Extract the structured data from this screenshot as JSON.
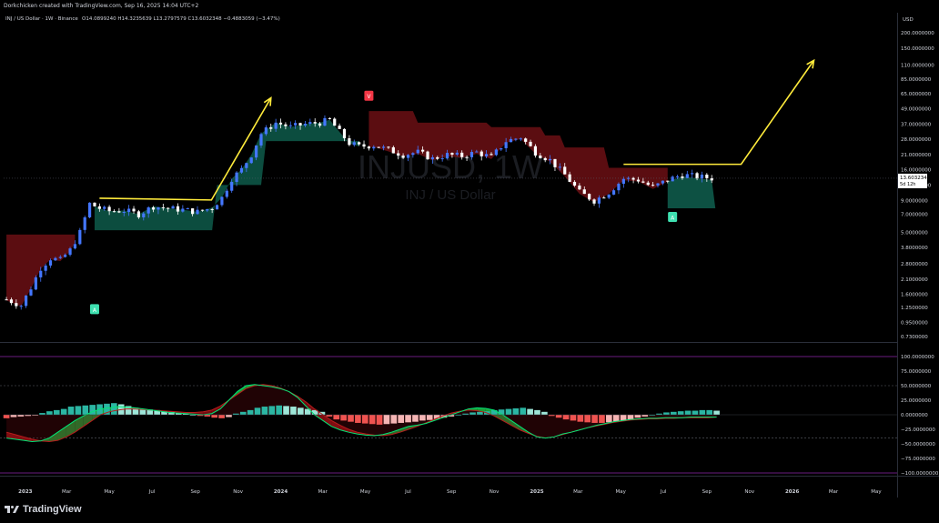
{
  "header": {
    "text": "Dorkchicken created with TradingView.com, Sep 16, 2025 14:04 UTC+2"
  },
  "footer": {
    "brand": "TradingView"
  },
  "chart_data": [
    {
      "type": "candlestick",
      "title": "INJ / US Dollar · 1W · Binance",
      "ohlc_text": "O14.0899240  H14.3235639  L13.2797579  C13.6032348  −0.4883059 (−3.47%)",
      "watermark": {
        "symbol": "INJUSD, 1W",
        "name": "INJ / US Dollar"
      },
      "currency": "USD",
      "scale": "log",
      "last_price": "13.6032348",
      "countdown": "5d 12h",
      "yticks": [
        "200.0000000",
        "150.0000000",
        "110.0000000",
        "85.0000000",
        "65.0000000",
        "49.0000000",
        "37.0000000",
        "28.0000000",
        "21.0000000",
        "16.0000000",
        "12.0000000",
        "9.0000000",
        "7.0000000",
        "5.0000000",
        "3.8000000",
        "2.8000000",
        "2.1000000",
        "1.6000000",
        "1.2500000",
        "0.9500000",
        "0.7300000"
      ],
      "xticks": [
        "2023",
        "Mar",
        "May",
        "Jul",
        "Sep",
        "Nov",
        "2024",
        "Mar",
        "May",
        "Jul",
        "Sep",
        "Nov",
        "2025",
        "Mar",
        "May",
        "Jul",
        "Sep",
        "Nov",
        "2026",
        "Mar",
        "May"
      ],
      "x_range": [
        "2022-12",
        "2026-05"
      ],
      "price_path": [
        [
          "2022-12-05",
          1.45
        ],
        [
          "2022-12-26",
          1.3
        ],
        [
          "2023-01-09",
          1.8
        ],
        [
          "2023-01-23",
          2.6
        ],
        [
          "2023-02-06",
          3.1
        ],
        [
          "2023-02-20",
          3.0
        ],
        [
          "2023-03-06",
          3.6
        ],
        [
          "2023-03-20",
          5.0
        ],
        [
          "2023-04-03",
          8.5
        ],
        [
          "2023-04-17",
          7.8
        ],
        [
          "2023-05-01",
          7.4
        ],
        [
          "2023-05-22",
          7.5
        ],
        [
          "2023-06-12",
          7.0
        ],
        [
          "2023-07-03",
          8.1
        ],
        [
          "2023-07-24",
          7.8
        ],
        [
          "2023-08-14",
          7.6
        ],
        [
          "2023-09-04",
          7.3
        ],
        [
          "2023-09-25",
          7.9
        ],
        [
          "2023-10-09",
          9.5
        ],
        [
          "2023-10-23",
          13.5
        ],
        [
          "2023-11-06",
          16.0
        ],
        [
          "2023-11-20",
          21.0
        ],
        [
          "2023-12-04",
          31.0
        ],
        [
          "2023-12-25",
          38.0
        ],
        [
          "2024-01-15",
          35.0
        ],
        [
          "2024-02-05",
          37.0
        ],
        [
          "2024-02-26",
          38.0
        ],
        [
          "2024-03-11",
          40.0
        ],
        [
          "2024-03-25",
          32.0
        ],
        [
          "2024-04-08",
          26.0
        ],
        [
          "2024-04-22",
          24.5
        ],
        [
          "2024-05-13",
          25.0
        ],
        [
          "2024-06-03",
          23.0
        ],
        [
          "2024-06-24",
          21.0
        ],
        [
          "2024-07-15",
          22.0
        ],
        [
          "2024-08-05",
          19.5
        ],
        [
          "2024-08-26",
          21.0
        ],
        [
          "2024-09-16",
          20.5
        ],
        [
          "2024-10-07",
          22.0
        ],
        [
          "2024-10-28",
          20.0
        ],
        [
          "2024-11-18",
          27.0
        ],
        [
          "2024-12-09",
          29.0
        ],
        [
          "2024-12-30",
          22.0
        ],
        [
          "2025-01-20",
          19.0
        ],
        [
          "2025-02-10",
          14.5
        ],
        [
          "2025-03-03",
          10.5
        ],
        [
          "2025-03-24",
          9.0
        ],
        [
          "2025-04-14",
          10.5
        ],
        [
          "2025-05-05",
          13.5
        ],
        [
          "2025-05-26",
          13.2
        ],
        [
          "2025-06-16",
          11.5
        ],
        [
          "2025-07-07",
          13.2
        ],
        [
          "2025-07-28",
          14.5
        ],
        [
          "2025-08-18",
          14.0
        ],
        [
          "2025-09-08",
          13.6
        ]
      ],
      "signals": [
        {
          "type": "buy",
          "label": "A",
          "date": "2023-04-10",
          "price": 1.2
        },
        {
          "type": "sell",
          "label": "V",
          "date": "2024-05-06",
          "price": 62
        },
        {
          "type": "buy",
          "label": "A",
          "date": "2025-07-14",
          "price": 6.6
        }
      ],
      "annotations": [
        {
          "type": "line",
          "color": "#ffeb3b",
          "points": [
            [
              "2023-04-17",
              9.4
            ],
            [
              "2023-09-24",
              9.1
            ],
            [
              "2023-12-18",
              60.0
            ]
          ],
          "arrow": true
        },
        {
          "type": "line",
          "color": "#ffeb3b",
          "points": [
            [
              "2025-05-05",
              17.6
            ],
            [
              "2025-10-20",
              17.6
            ],
            [
              "2026-02-01",
              120.0
            ]
          ],
          "arrow": true
        }
      ],
      "colors": {
        "bull": "#4477ff",
        "bear": "#ffffff",
        "band_bull": "#0e5a4a",
        "band_bear": "#6b0f14",
        "signal_buy": "#3ee0b0",
        "signal_sell": "#f23645",
        "arrow": "#ffeb3b"
      }
    },
    {
      "type": "oscillator",
      "yticks": [
        "100.0000000",
        "75.0000000",
        "50.0000000",
        "25.0000000",
        "0.0000000",
        "−25.0000000",
        "−50.0000000",
        "−75.0000000",
        "−100.0000000"
      ],
      "ylim": [
        -100,
        100
      ],
      "reference_lines": [
        100,
        50,
        -40,
        -100
      ],
      "histogram": [
        -6,
        -4,
        -3,
        -2,
        -1,
        3,
        6,
        8,
        10,
        14,
        15,
        16,
        17,
        18,
        19,
        20,
        18,
        15,
        12,
        10,
        9,
        8,
        6,
        5,
        3,
        2,
        0,
        -2,
        -3,
        -5,
        -6,
        -4,
        2,
        5,
        8,
        12,
        14,
        15,
        16,
        15,
        14,
        12,
        10,
        8,
        5,
        -3,
        -8,
        -10,
        -12,
        -14,
        -15,
        -16,
        -17,
        -16,
        -15,
        -14,
        -13,
        -12,
        -10,
        -9,
        -7,
        -5,
        -3,
        0,
        2,
        4,
        5,
        6,
        8,
        9,
        10,
        11,
        12,
        10,
        8,
        5,
        -2,
        -5,
        -8,
        -10,
        -12,
        -13,
        -14,
        -14,
        -13,
        -12,
        -10,
        -8,
        -5,
        -3,
        0,
        2,
        4,
        5,
        6,
        7,
        7,
        8,
        8,
        7
      ],
      "wave_fast": [
        -40,
        -42,
        -44,
        -46,
        -45,
        -40,
        -30,
        -20,
        -10,
        -2,
        5,
        10,
        12,
        14,
        13,
        12,
        10,
        8,
        6,
        4,
        3,
        2,
        1,
        0,
        2,
        10,
        25,
        40,
        50,
        52,
        50,
        48,
        45,
        40,
        30,
        15,
        0,
        -10,
        -20,
        -26,
        -30,
        -33,
        -35,
        -36,
        -34,
        -30,
        -25,
        -20,
        -18,
        -15,
        -10,
        -5,
        0,
        5,
        10,
        12,
        11,
        8,
        0,
        -10,
        -20,
        -30,
        -38,
        -40,
        -38,
        -33,
        -30,
        -26,
        -22,
        -18,
        -15,
        -12,
        -10,
        -8,
        -7,
        -6,
        -6,
        -5,
        -5,
        -5,
        -4,
        -4,
        -4,
        -4,
        -3
      ],
      "wave_slow": [
        -30,
        -34,
        -38,
        -42,
        -45,
        -46,
        -44,
        -38,
        -30,
        -20,
        -10,
        0,
        5,
        8,
        10,
        10,
        9,
        8,
        7,
        6,
        5,
        4,
        4,
        5,
        8,
        15,
        25,
        35,
        45,
        50,
        52,
        50,
        46,
        40,
        32,
        22,
        10,
        0,
        -10,
        -18,
        -25,
        -30,
        -33,
        -35,
        -36,
        -34,
        -30,
        -25,
        -20,
        -14,
        -8,
        -2,
        3,
        6,
        8,
        7,
        4,
        -2,
        -10,
        -18,
        -26,
        -32,
        -37,
        -40,
        -38,
        -34,
        -30,
        -26,
        -22,
        -19,
        -16,
        -13,
        -11,
        -9,
        -8,
        -7,
        -7,
        -6,
        -6,
        -5,
        -5,
        -5,
        -5,
        -4
      ],
      "colors": {
        "hist_pos": "#2bb6a3",
        "hist_pos_light": "#9de6d8",
        "hist_neg": "#ef5350",
        "hist_neg_light": "#f4b5b4",
        "wave_up": "#00e676",
        "wave_down": "#b71c1c",
        "wave_fill_up": "#1fae3d",
        "wave_fill_down": "#8f0e13"
      }
    }
  ]
}
